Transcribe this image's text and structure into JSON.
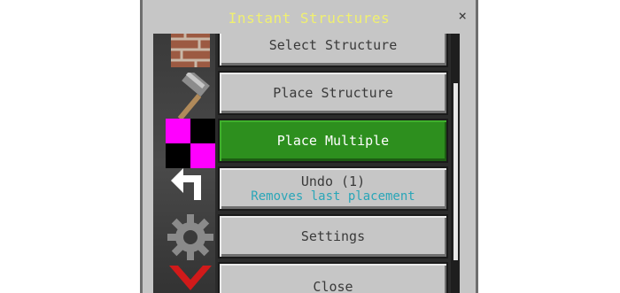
{
  "window": {
    "title": "Instant Structures",
    "close_glyph": "×"
  },
  "menu": {
    "items": [
      {
        "label": "Select Structure",
        "icon": "brick-block-icon"
      },
      {
        "label": "Place Structure",
        "icon": "hammer-icon"
      },
      {
        "label": "Place Multiple",
        "icon": "magenta-checker-icon",
        "active": true
      },
      {
        "label": "Undo (1)",
        "sublabel": "Removes last placement",
        "icon": "undo-arrow-icon"
      },
      {
        "label": "Settings",
        "icon": "gear-icon"
      },
      {
        "label": "Close",
        "icon": "chevron-down-icon"
      }
    ]
  },
  "colors": {
    "title": "#f0f070",
    "active_button": "#2d8f1e",
    "sublabel": "#2aa6b8",
    "button": "#c6c6c6"
  }
}
